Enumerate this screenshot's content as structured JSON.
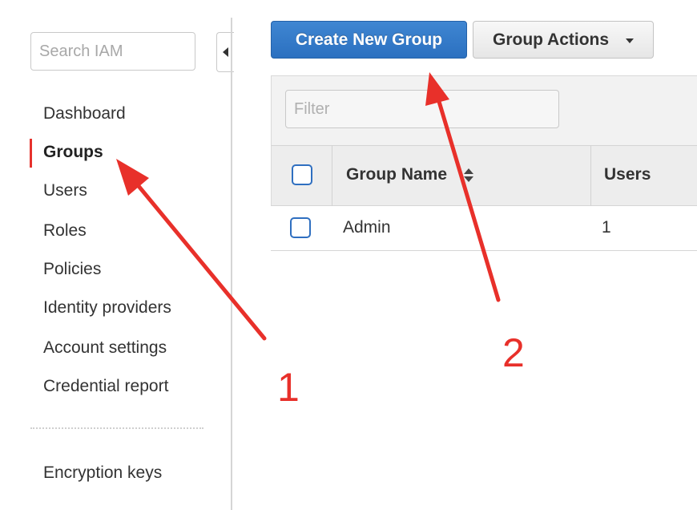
{
  "sidebar": {
    "search_placeholder": "Search IAM",
    "items": [
      {
        "label": "Dashboard"
      },
      {
        "label": "Groups"
      },
      {
        "label": "Users"
      },
      {
        "label": "Roles"
      },
      {
        "label": "Policies"
      },
      {
        "label": "Identity providers"
      },
      {
        "label": "Account settings"
      },
      {
        "label": "Credential report"
      }
    ],
    "secondary_items": [
      {
        "label": "Encryption keys"
      }
    ],
    "active_item": "Groups"
  },
  "toolbar": {
    "create_label": "Create New Group",
    "actions_label": "Group Actions",
    "primary_color": "#2f77c8"
  },
  "filter": {
    "placeholder": "Filter"
  },
  "table": {
    "columns": [
      "Group Name",
      "Users"
    ],
    "rows": [
      {
        "name": "Admin",
        "users": "1"
      }
    ]
  },
  "annotations": {
    "color": "#e8302a",
    "labels": [
      "1",
      "2"
    ]
  }
}
